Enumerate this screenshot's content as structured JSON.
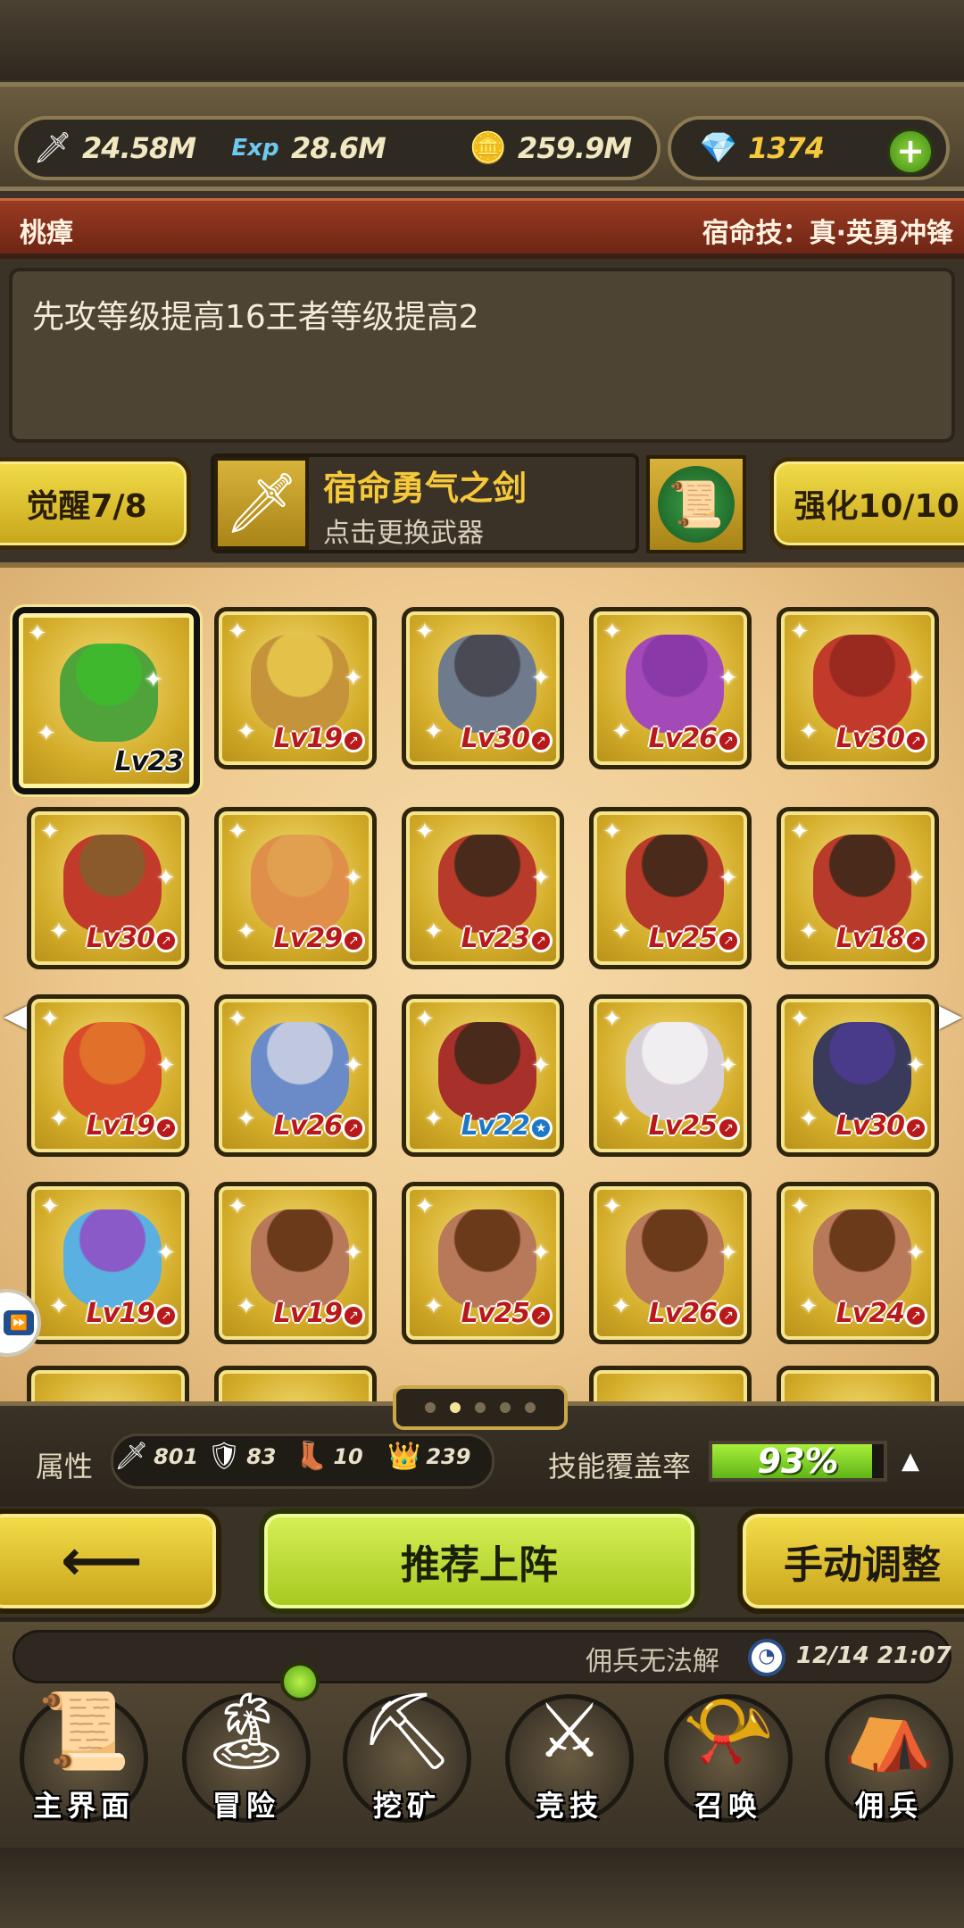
{
  "currency": {
    "attack": "24.58M",
    "exp": "28.6M",
    "gold": "259.9M",
    "gems": "1374",
    "exp_icon_label": "Exp",
    "add_label": "+"
  },
  "hero": {
    "name": "桃瘴",
    "fate_skill": "宿命技：真·英勇冲锋",
    "description": "先攻等级提高16王者等级提高2"
  },
  "weapon": {
    "awaken": "觉醒7/8",
    "name": "宿命勇气之剑",
    "hint": "点击更换武器",
    "enhance": "强化10/10"
  },
  "roster": [
    {
      "level": "Lv23",
      "color": "#4fa33a",
      "hair": "#3fb82e",
      "badge": "none",
      "selected": true
    },
    {
      "level": "Lv19",
      "color": "#c4933a",
      "hair": "#e4c24a",
      "badge": "red"
    },
    {
      "level": "Lv30",
      "color": "#6f7a8c",
      "hair": "#4a4a55",
      "badge": "red"
    },
    {
      "level": "Lv26",
      "color": "#a34ab8",
      "hair": "#8a3aa8",
      "badge": "red"
    },
    {
      "level": "Lv30",
      "color": "#c23a2a",
      "hair": "#9a2a20",
      "badge": "red"
    },
    {
      "level": "Lv30",
      "color": "#c23a2a",
      "hair": "#8a5a2a",
      "badge": "red"
    },
    {
      "level": "Lv29",
      "color": "#e08f4a",
      "hair": "#e0a050",
      "badge": "red"
    },
    {
      "level": "Lv23",
      "color": "#b83a2a",
      "hair": "#4a2a1a",
      "badge": "red"
    },
    {
      "level": "Lv25",
      "color": "#b83a2a",
      "hair": "#4a2a1a",
      "badge": "red"
    },
    {
      "level": "Lv18",
      "color": "#b83a2a",
      "hair": "#4a2a1a",
      "badge": "red"
    },
    {
      "level": "Lv19",
      "color": "#d84a2a",
      "hair": "#e0702a",
      "badge": "red"
    },
    {
      "level": "Lv26",
      "color": "#6a8ac8",
      "hair": "#c0c8e0",
      "badge": "red"
    },
    {
      "level": "Lv22",
      "color": "#a8302a",
      "hair": "#4a2a1a",
      "badge": "blue"
    },
    {
      "level": "Lv25",
      "color": "#d8d0d8",
      "hair": "#f0eef0",
      "badge": "red"
    },
    {
      "level": "Lv30",
      "color": "#3a3a5a",
      "hair": "#4a3a8a",
      "badge": "red"
    },
    {
      "level": "Lv19",
      "color": "#5ab0e0",
      "hair": "#8a5ac8",
      "badge": "red"
    },
    {
      "level": "Lv19",
      "color": "#b8785a",
      "hair": "#6a3a1a",
      "badge": "red"
    },
    {
      "level": "Lv25",
      "color": "#b8785a",
      "hair": "#6a3a1a",
      "badge": "red"
    },
    {
      "level": "Lv26",
      "color": "#b8785a",
      "hair": "#6a3a1a",
      "badge": "red"
    },
    {
      "level": "Lv24",
      "color": "#b8785a",
      "hair": "#6a3a1a",
      "badge": "red"
    }
  ],
  "pager": {
    "pages": 5,
    "active": 1
  },
  "stats": {
    "label": "属性",
    "attack": "801",
    "defense": "83",
    "speed": "10",
    "crown": "239",
    "coverage_label": "技能覆盖率",
    "coverage": "93%",
    "coverage_value": 0.93
  },
  "actions": {
    "back": "⟵",
    "recommend": "推荐上阵",
    "manual": "手动调整"
  },
  "ticker": {
    "text": "佣兵无法解",
    "time": "12/14 21:07"
  },
  "nav": [
    {
      "label": "主界面",
      "icon": "📜",
      "name": "nav-main"
    },
    {
      "label": "冒险",
      "icon": "🏝",
      "name": "nav-adventure"
    },
    {
      "label": "挖矿",
      "icon": "⛏",
      "name": "nav-mining"
    },
    {
      "label": "竞技",
      "icon": "⚔",
      "name": "nav-arena"
    },
    {
      "label": "召唤",
      "icon": "📯",
      "name": "nav-summon"
    },
    {
      "label": "佣兵",
      "icon": "⛺",
      "name": "nav-mercenary"
    }
  ]
}
